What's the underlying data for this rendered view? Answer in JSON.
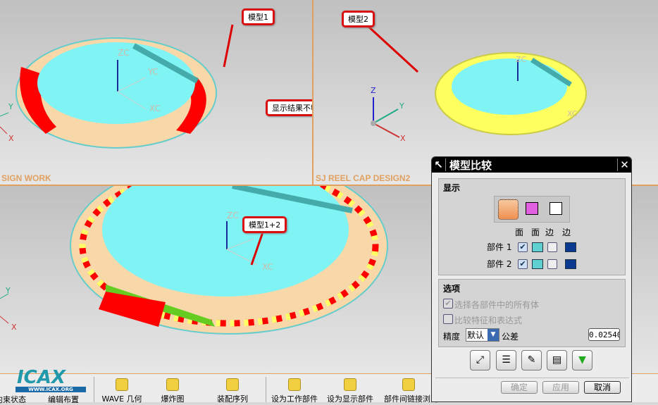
{
  "viewports": {
    "top_left": {
      "label": "SIGN WORK",
      "callout": "模型1",
      "note": "显示结果不够直观"
    },
    "top_right": {
      "label": "SJ REEL CAP DESIGN2",
      "callout": "模型2"
    },
    "bottom": {
      "callout": "模型1+2"
    },
    "axes": {
      "zc": "ZC",
      "yc": "YC",
      "xc": "XC",
      "z": "Z",
      "y": "Y",
      "x": "X"
    }
  },
  "toolbar": {
    "logo": "ICAX",
    "logo_sub": "WWW.ICAX.ORG",
    "items": [
      {
        "label": "约束状态",
        "icon": "constraint-icon"
      },
      {
        "label": "编辑布置",
        "icon": "arrangement-icon"
      },
      {
        "label": "WAVE 几何",
        "icon": "wave-link-icon"
      },
      {
        "label": "爆炸图",
        "icon": "exploded-view-icon"
      },
      {
        "label": "装配序列",
        "icon": "sequence-icon"
      },
      {
        "label": "设为工作部件",
        "icon": "work-part-icon"
      },
      {
        "label": "设为显示部件",
        "icon": "display-part-icon"
      },
      {
        "label": "部件间链接浏览",
        "icon": "link-browser-icon"
      }
    ]
  },
  "dialog": {
    "title": "模型比较",
    "display": {
      "title": "显示",
      "col_headers": [
        "面",
        "面",
        "边",
        "边"
      ],
      "rows": [
        {
          "label": "部件 1",
          "checked": true
        },
        {
          "label": "部件 2",
          "checked": true
        }
      ]
    },
    "options": {
      "title": "选项",
      "opt1": "选择各部件中的所有体",
      "opt2": "比较特征和表达式",
      "precision_label": "精度",
      "precision_value": "默认",
      "tolerance_label": "公差",
      "tolerance_value": "0.02540"
    },
    "buttons": {
      "ok": "确定",
      "apply": "应用",
      "cancel": "取消"
    },
    "colors": {
      "face": "#5fcfd0",
      "edge": "#0a3a8f"
    }
  }
}
